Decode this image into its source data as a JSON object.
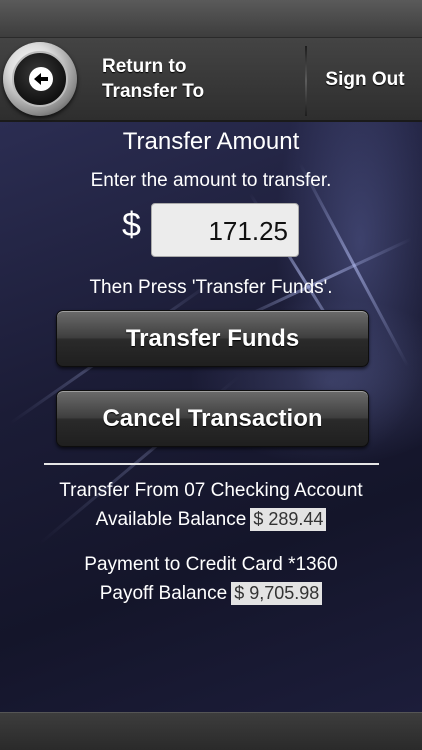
{
  "header": {
    "back_label": "Return to\nTransfer To",
    "signout_label": "Sign Out"
  },
  "transfer": {
    "title": "Transfer Amount",
    "instructions": "Enter the amount to transfer.",
    "currency_symbol": "$",
    "amount": "171.25",
    "then_press": "Then Press 'Transfer Funds'.",
    "transfer_button": "Transfer Funds",
    "cancel_button": "Cancel Transaction"
  },
  "accounts": {
    "from_line": "Transfer From 07 Checking Account",
    "available_label": "Available Balance",
    "available_value": "$ 289.44",
    "to_line": "Payment to Credit Card *1360",
    "payoff_label": "Payoff Balance",
    "payoff_value": "$ 9,705.98"
  },
  "colors": {
    "background": "#1b1c36",
    "header": "#3a3a3a",
    "button": "#333333",
    "text": "#ffffff"
  }
}
